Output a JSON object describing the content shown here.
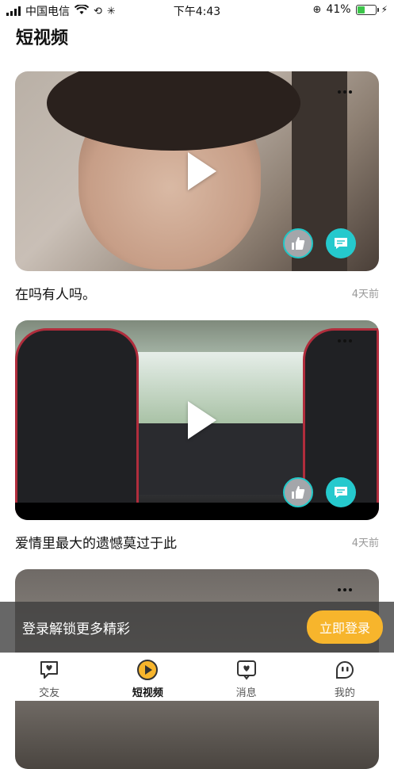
{
  "status_bar": {
    "carrier": "中国电信",
    "time": "下午4:43",
    "battery_percent": "41%",
    "battery_level": 0.41
  },
  "page": {
    "title": "短视频"
  },
  "videos": [
    {
      "title": "在吗有人吗。",
      "time": "4天前"
    },
    {
      "title": "爱情里最大的遗憾莫过于此",
      "time": "4天前"
    }
  ],
  "login_banner": {
    "text": "登录解锁更多精彩",
    "button": "立即登录"
  },
  "tabs": [
    {
      "label": "交友",
      "icon": "heart-chat-icon"
    },
    {
      "label": "短视频",
      "icon": "play-circle-icon",
      "active": true
    },
    {
      "label": "消息",
      "icon": "message-heart-icon"
    },
    {
      "label": "我的",
      "icon": "profile-face-icon"
    }
  ],
  "colors": {
    "accent": "#f7b52c",
    "teal": "#25c9cd"
  }
}
